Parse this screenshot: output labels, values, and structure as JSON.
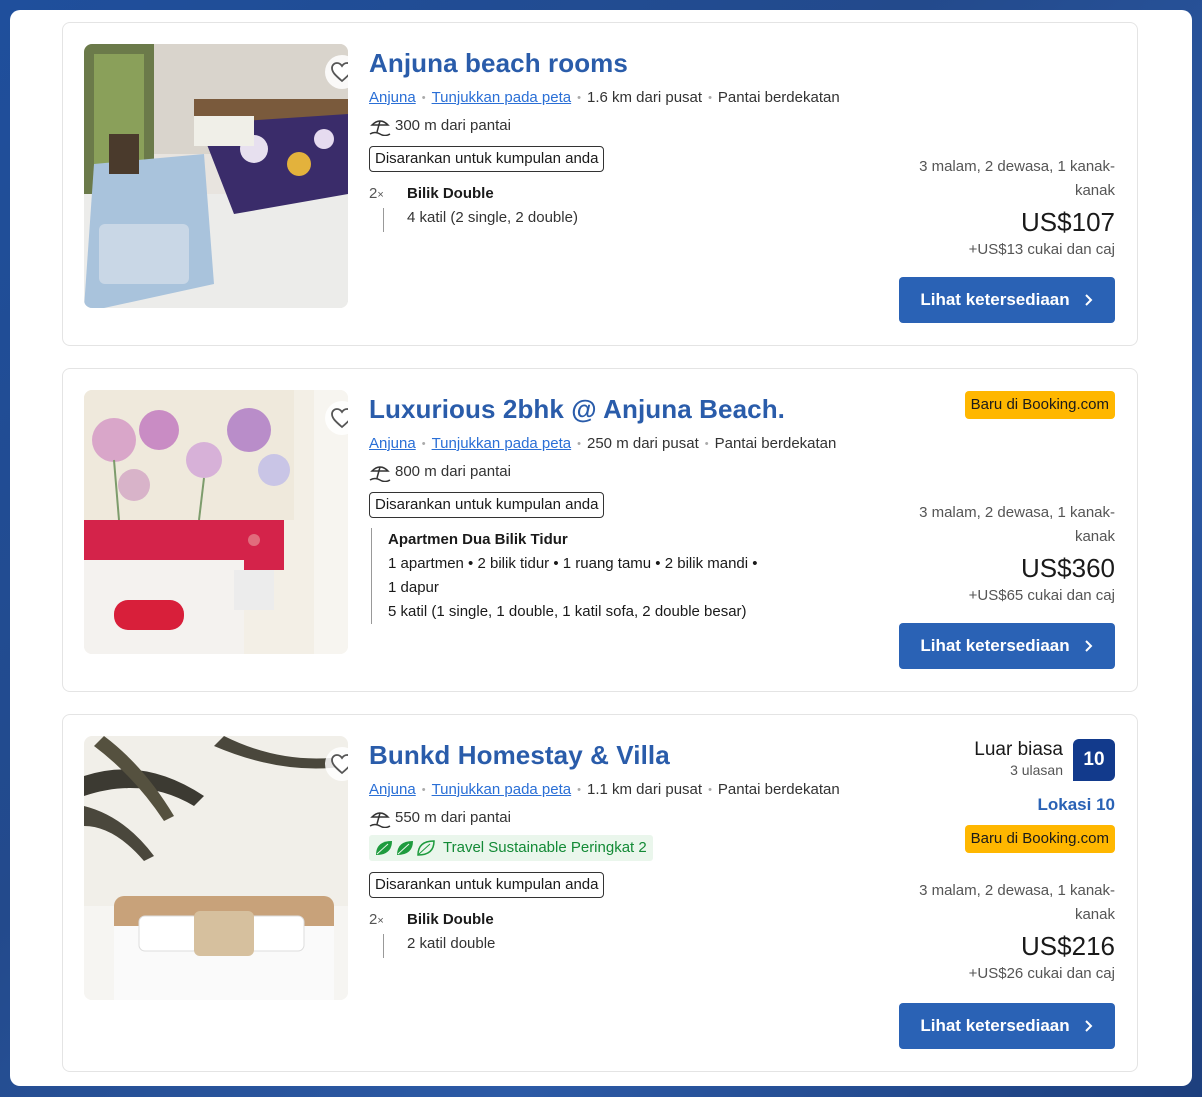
{
  "listings": [
    {
      "title": "Anjuna beach rooms",
      "area": "Anjuna",
      "map_link": "Tunjukkan pada peta",
      "distance": "1.6 km dari pusat",
      "beach_tag": "Pantai berdekatan",
      "beach_distance": "300 m dari pantai",
      "recommend": "Disarankan untuk kumpulan anda",
      "room_mult": "2",
      "room_name": "Bilik Double",
      "room_desc": "4 katil (2 single, 2 double)",
      "stay_info": "3 malam, 2 dewasa, 1 kanak-kanak",
      "price": "US$107",
      "tax": "+US$13 cukai dan caj",
      "cta": "Lihat ketersediaan"
    },
    {
      "title": "Luxurious 2bhk @ Anjuna Beach.",
      "area": "Anjuna",
      "map_link": "Tunjukkan pada peta",
      "distance": "250 m dari pusat",
      "beach_tag": "Pantai berdekatan",
      "beach_distance": "800 m dari pantai",
      "recommend": "Disarankan untuk kumpulan anda",
      "new_badge": "Baru di Booking.com",
      "apt_name": "Apartmen Dua Bilik Tidur",
      "apt_line1": "1 apartmen • 2 bilik tidur • 1 ruang tamu • 2 bilik mandi •",
      "apt_line2": "1 dapur",
      "apt_line3": "5 katil (1 single, 1 double, 1 katil sofa, 2 double besar)",
      "stay_info": "3 malam, 2 dewasa, 1 kanak-kanak",
      "price": "US$360",
      "tax": "+US$65 cukai dan caj",
      "cta": "Lihat ketersediaan"
    },
    {
      "title": "Bunkd Homestay & Villa",
      "area": "Anjuna",
      "map_link": "Tunjukkan pada peta",
      "distance": "1.1 km dari pusat",
      "beach_tag": "Pantai berdekatan",
      "beach_distance": "550 m dari pantai",
      "sustainable": "Travel Sustainable Peringkat 2",
      "recommend": "Disarankan untuk kumpulan anda",
      "room_mult": "2",
      "room_name": "Bilik Double",
      "room_desc": "2 katil double",
      "score_word": "Luar biasa",
      "score_count": "3 ulasan",
      "score": "10",
      "location_score": "Lokasi 10",
      "new_badge": "Baru di Booking.com",
      "stay_info": "3 malam, 2 dewasa, 1 kanak-kanak",
      "price": "US$216",
      "tax": "+US$26 cukai dan caj",
      "cta": "Lihat ketersediaan"
    }
  ],
  "colors": {
    "title": "#2a5caa",
    "link": "#2a6fd6",
    "button": "#2a62b5",
    "badge_yellow": "#ffb700",
    "score_box": "#123a8c",
    "sustainable_green": "#138a36"
  },
  "icons": [
    "heart-icon",
    "beach-umbrella-icon",
    "chevron-right-icon",
    "leaf-icon"
  ]
}
